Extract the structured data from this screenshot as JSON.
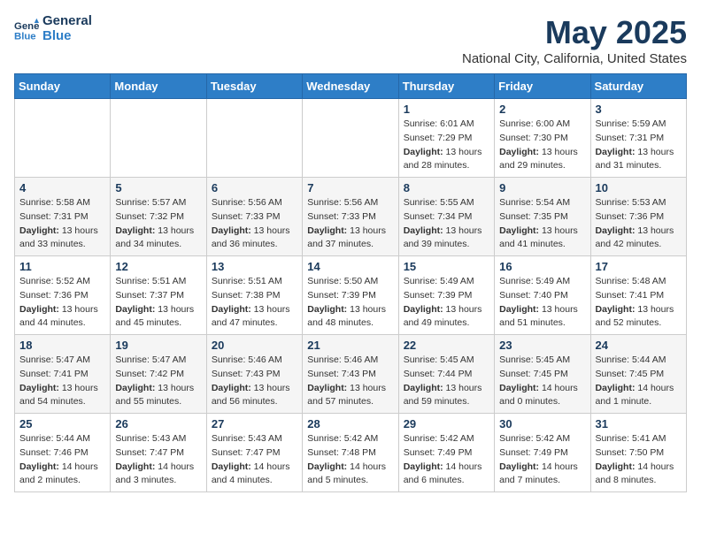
{
  "header": {
    "logo_line1": "General",
    "logo_line2": "Blue",
    "month": "May 2025",
    "location": "National City, California, United States"
  },
  "weekdays": [
    "Sunday",
    "Monday",
    "Tuesday",
    "Wednesday",
    "Thursday",
    "Friday",
    "Saturday"
  ],
  "weeks": [
    [
      {
        "day": "",
        "info": ""
      },
      {
        "day": "",
        "info": ""
      },
      {
        "day": "",
        "info": ""
      },
      {
        "day": "",
        "info": ""
      },
      {
        "day": "1",
        "info": "Sunrise: 6:01 AM\nSunset: 7:29 PM\nDaylight: 13 hours\nand 28 minutes."
      },
      {
        "day": "2",
        "info": "Sunrise: 6:00 AM\nSunset: 7:30 PM\nDaylight: 13 hours\nand 29 minutes."
      },
      {
        "day": "3",
        "info": "Sunrise: 5:59 AM\nSunset: 7:31 PM\nDaylight: 13 hours\nand 31 minutes."
      }
    ],
    [
      {
        "day": "4",
        "info": "Sunrise: 5:58 AM\nSunset: 7:31 PM\nDaylight: 13 hours\nand 33 minutes."
      },
      {
        "day": "5",
        "info": "Sunrise: 5:57 AM\nSunset: 7:32 PM\nDaylight: 13 hours\nand 34 minutes."
      },
      {
        "day": "6",
        "info": "Sunrise: 5:56 AM\nSunset: 7:33 PM\nDaylight: 13 hours\nand 36 minutes."
      },
      {
        "day": "7",
        "info": "Sunrise: 5:56 AM\nSunset: 7:33 PM\nDaylight: 13 hours\nand 37 minutes."
      },
      {
        "day": "8",
        "info": "Sunrise: 5:55 AM\nSunset: 7:34 PM\nDaylight: 13 hours\nand 39 minutes."
      },
      {
        "day": "9",
        "info": "Sunrise: 5:54 AM\nSunset: 7:35 PM\nDaylight: 13 hours\nand 41 minutes."
      },
      {
        "day": "10",
        "info": "Sunrise: 5:53 AM\nSunset: 7:36 PM\nDaylight: 13 hours\nand 42 minutes."
      }
    ],
    [
      {
        "day": "11",
        "info": "Sunrise: 5:52 AM\nSunset: 7:36 PM\nDaylight: 13 hours\nand 44 minutes."
      },
      {
        "day": "12",
        "info": "Sunrise: 5:51 AM\nSunset: 7:37 PM\nDaylight: 13 hours\nand 45 minutes."
      },
      {
        "day": "13",
        "info": "Sunrise: 5:51 AM\nSunset: 7:38 PM\nDaylight: 13 hours\nand 47 minutes."
      },
      {
        "day": "14",
        "info": "Sunrise: 5:50 AM\nSunset: 7:39 PM\nDaylight: 13 hours\nand 48 minutes."
      },
      {
        "day": "15",
        "info": "Sunrise: 5:49 AM\nSunset: 7:39 PM\nDaylight: 13 hours\nand 49 minutes."
      },
      {
        "day": "16",
        "info": "Sunrise: 5:49 AM\nSunset: 7:40 PM\nDaylight: 13 hours\nand 51 minutes."
      },
      {
        "day": "17",
        "info": "Sunrise: 5:48 AM\nSunset: 7:41 PM\nDaylight: 13 hours\nand 52 minutes."
      }
    ],
    [
      {
        "day": "18",
        "info": "Sunrise: 5:47 AM\nSunset: 7:41 PM\nDaylight: 13 hours\nand 54 minutes."
      },
      {
        "day": "19",
        "info": "Sunrise: 5:47 AM\nSunset: 7:42 PM\nDaylight: 13 hours\nand 55 minutes."
      },
      {
        "day": "20",
        "info": "Sunrise: 5:46 AM\nSunset: 7:43 PM\nDaylight: 13 hours\nand 56 minutes."
      },
      {
        "day": "21",
        "info": "Sunrise: 5:46 AM\nSunset: 7:43 PM\nDaylight: 13 hours\nand 57 minutes."
      },
      {
        "day": "22",
        "info": "Sunrise: 5:45 AM\nSunset: 7:44 PM\nDaylight: 13 hours\nand 59 minutes."
      },
      {
        "day": "23",
        "info": "Sunrise: 5:45 AM\nSunset: 7:45 PM\nDaylight: 14 hours\nand 0 minutes."
      },
      {
        "day": "24",
        "info": "Sunrise: 5:44 AM\nSunset: 7:45 PM\nDaylight: 14 hours\nand 1 minute."
      }
    ],
    [
      {
        "day": "25",
        "info": "Sunrise: 5:44 AM\nSunset: 7:46 PM\nDaylight: 14 hours\nand 2 minutes."
      },
      {
        "day": "26",
        "info": "Sunrise: 5:43 AM\nSunset: 7:47 PM\nDaylight: 14 hours\nand 3 minutes."
      },
      {
        "day": "27",
        "info": "Sunrise: 5:43 AM\nSunset: 7:47 PM\nDaylight: 14 hours\nand 4 minutes."
      },
      {
        "day": "28",
        "info": "Sunrise: 5:42 AM\nSunset: 7:48 PM\nDaylight: 14 hours\nand 5 minutes."
      },
      {
        "day": "29",
        "info": "Sunrise: 5:42 AM\nSunset: 7:49 PM\nDaylight: 14 hours\nand 6 minutes."
      },
      {
        "day": "30",
        "info": "Sunrise: 5:42 AM\nSunset: 7:49 PM\nDaylight: 14 hours\nand 7 minutes."
      },
      {
        "day": "31",
        "info": "Sunrise: 5:41 AM\nSunset: 7:50 PM\nDaylight: 14 hours\nand 8 minutes."
      }
    ]
  ]
}
